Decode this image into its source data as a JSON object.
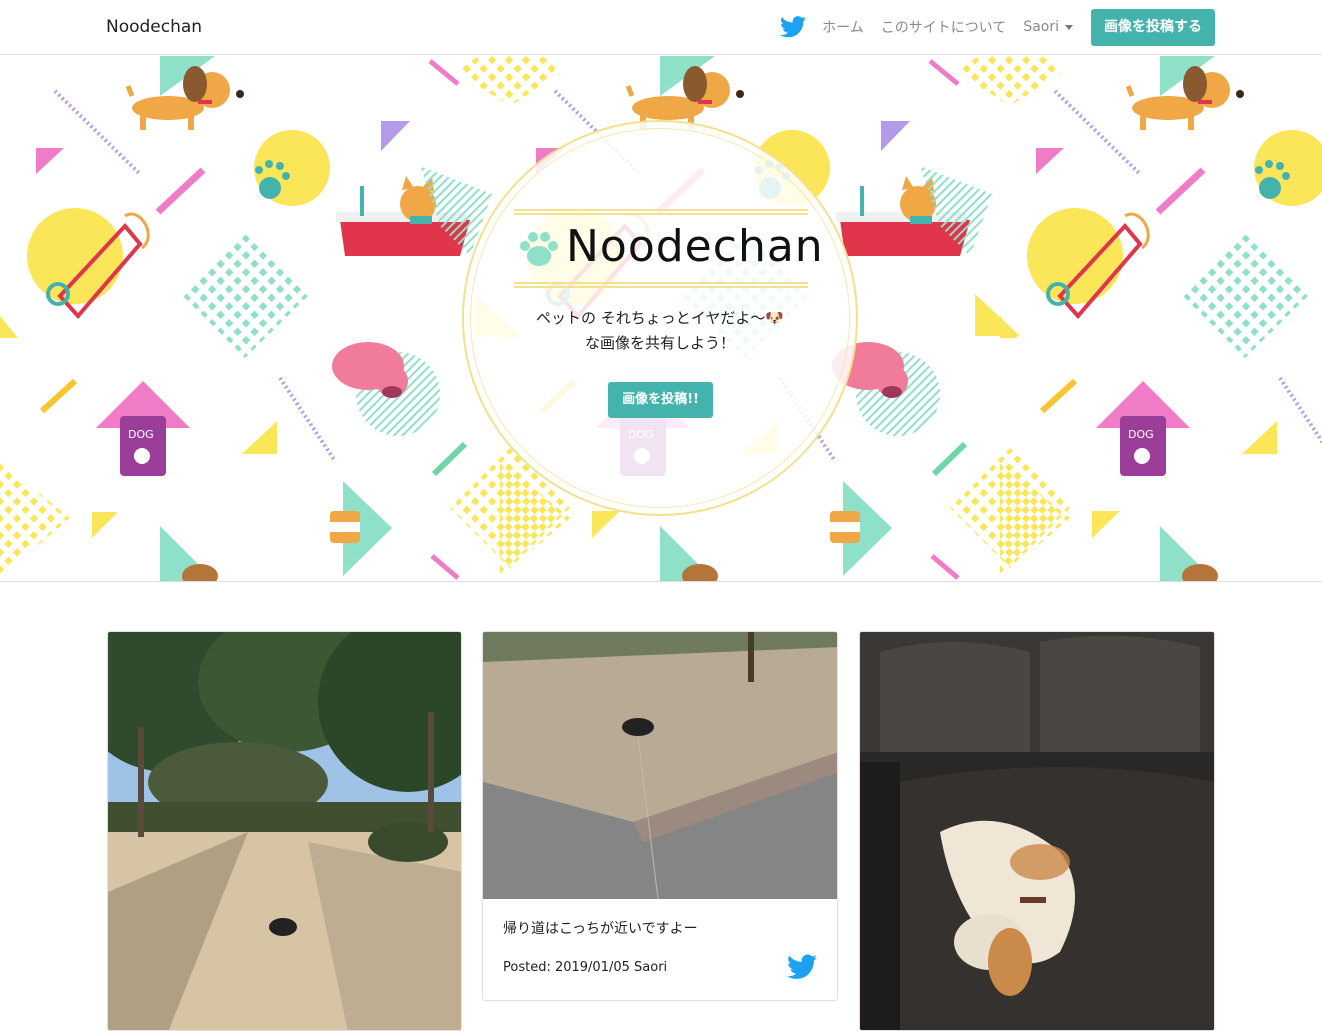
{
  "navbar": {
    "brand": "Noodechan",
    "links": [
      "ホーム",
      "このサイトについて"
    ],
    "user": "Saori",
    "post_button": "画像を投稿する",
    "twitter_icon": "twitter-icon"
  },
  "hero": {
    "title": "Noodechan",
    "subtitle_line1": "ペットの それちょっとイヤだよ〜🐶",
    "subtitle_line2": "な画像を共有しよう！",
    "button": "画像を投稿!!",
    "icon": "paw-icon"
  },
  "cards": [
    {
      "image": "park-path-dog-photo"
    },
    {
      "image": "road-dog-photo",
      "caption": "帰り道はこっちが近いですよー",
      "meta": "Posted: 2019/01/05 Saori",
      "icon": "twitter-icon"
    },
    {
      "image": "beagle-sofa-photo"
    }
  ],
  "colors": {
    "accent": "#45b3ad",
    "twitter": "#1da1f2",
    "gold": "#f3e18e"
  }
}
